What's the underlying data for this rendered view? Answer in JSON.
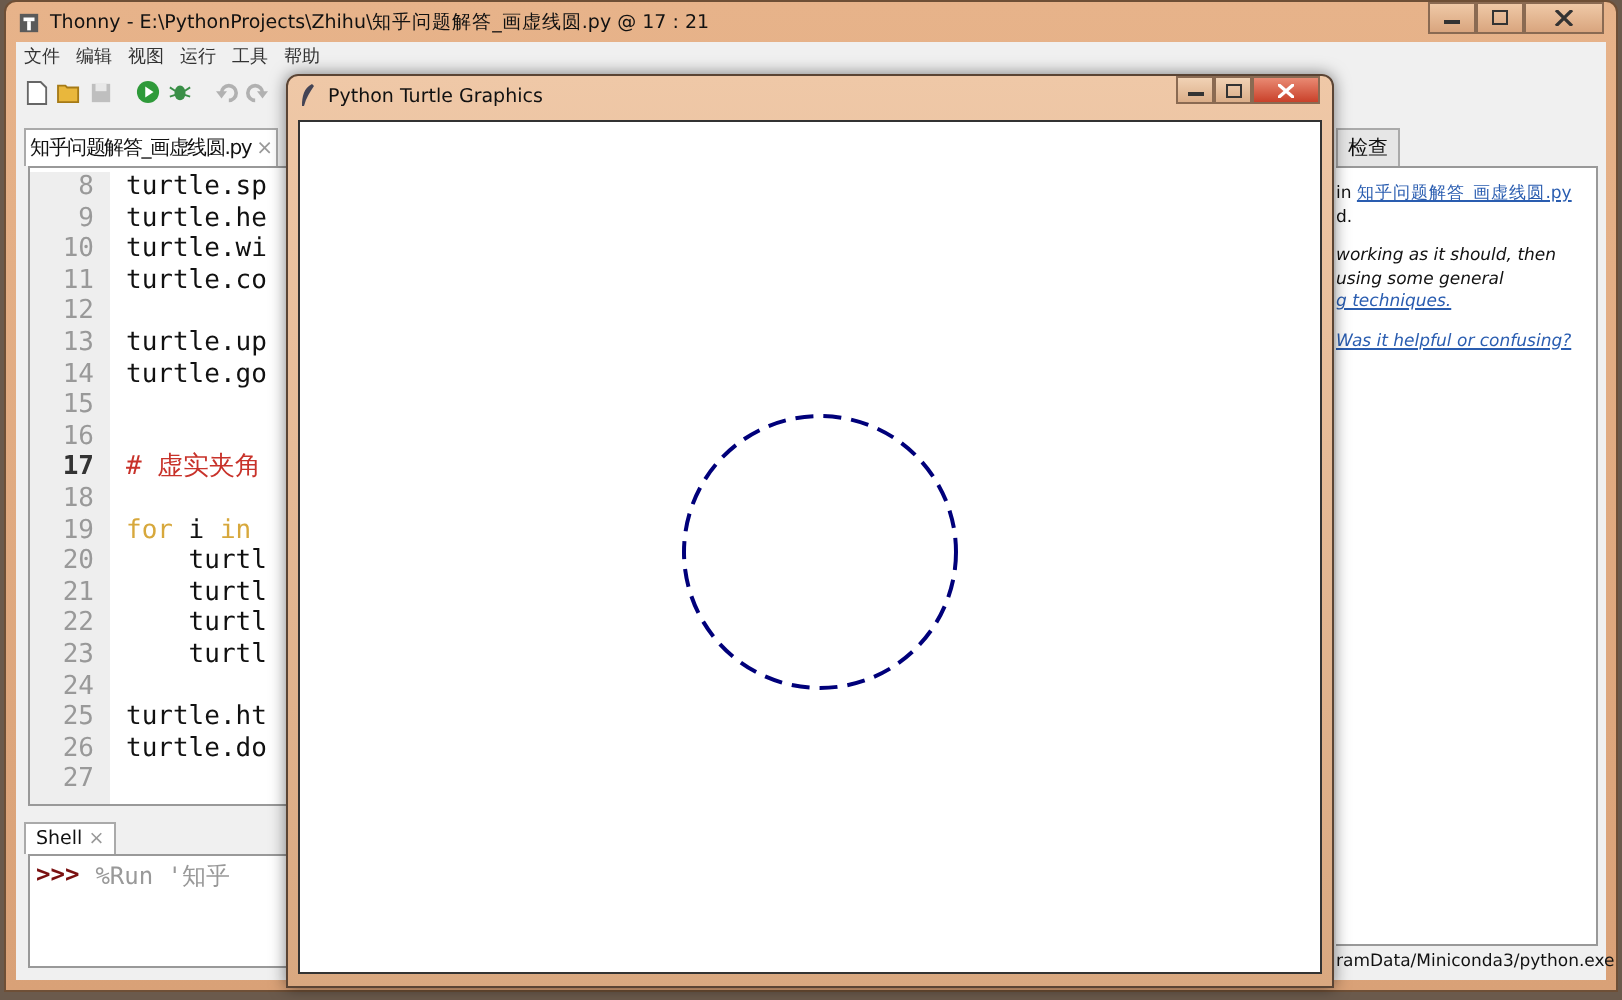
{
  "window": {
    "title": "Thonny  -  E:\\PythonProjects\\Zhihu\\知乎问题解答_画虚线圆.py  @  17 : 21"
  },
  "menu": [
    "文件",
    "编辑",
    "视图",
    "运行",
    "工具",
    "帮助"
  ],
  "toolbar": [
    {
      "kind": "new",
      "disabled": false
    },
    {
      "kind": "open",
      "disabled": false
    },
    {
      "kind": "save",
      "disabled": true
    },
    {
      "kind": "run",
      "disabled": false
    },
    {
      "kind": "debug",
      "disabled": false
    },
    {
      "kind": "undo",
      "disabled": true
    },
    {
      "kind": "redo",
      "disabled": true
    }
  ],
  "editor": {
    "tab": {
      "label": "知乎问题解答_画虚线圆.py",
      "close": "×"
    },
    "lines": [
      {
        "number": "8",
        "current": false,
        "tokens": [
          {
            "kind": "plain",
            "text": "turtle.sp"
          }
        ]
      },
      {
        "number": "9",
        "current": false,
        "tokens": [
          {
            "kind": "plain",
            "text": "turtle.he"
          }
        ]
      },
      {
        "number": "10",
        "current": false,
        "tokens": [
          {
            "kind": "plain",
            "text": "turtle.wi"
          }
        ]
      },
      {
        "number": "11",
        "current": false,
        "tokens": [
          {
            "kind": "plain",
            "text": "turtle.co"
          }
        ]
      },
      {
        "number": "12",
        "current": false
      },
      {
        "number": "13",
        "current": false,
        "tokens": [
          {
            "kind": "plain",
            "text": "turtle.up"
          }
        ]
      },
      {
        "number": "14",
        "current": false,
        "tokens": [
          {
            "kind": "plain",
            "text": "turtle.go"
          }
        ]
      },
      {
        "number": "15",
        "current": false
      },
      {
        "number": "16",
        "current": false
      },
      {
        "number": "17",
        "current": true,
        "tokens": [
          {
            "kind": "comment",
            "text": "# 虚实夹角"
          }
        ]
      },
      {
        "number": "18",
        "current": false
      },
      {
        "number": "19",
        "current": false,
        "tokens": [
          {
            "kind": "keyword",
            "text": "for"
          },
          {
            "kind": "plain",
            "text": " i "
          },
          {
            "kind": "keyword",
            "text": "in"
          }
        ]
      },
      {
        "number": "20",
        "current": false,
        "tokens": [
          {
            "kind": "plain",
            "text": "    turtl"
          }
        ]
      },
      {
        "number": "21",
        "current": false,
        "tokens": [
          {
            "kind": "plain",
            "text": "    turtl"
          }
        ]
      },
      {
        "number": "22",
        "current": false,
        "tokens": [
          {
            "kind": "plain",
            "text": "    turtl"
          }
        ]
      },
      {
        "number": "23",
        "current": false,
        "tokens": [
          {
            "kind": "plain",
            "text": "    turtl"
          }
        ]
      },
      {
        "number": "24",
        "current": false
      },
      {
        "number": "25",
        "current": false,
        "tokens": [
          {
            "kind": "plain",
            "text": "turtle.ht"
          }
        ]
      },
      {
        "number": "26",
        "current": false,
        "tokens": [
          {
            "kind": "plain",
            "text": "turtle.do"
          }
        ]
      },
      {
        "number": "27",
        "current": false
      }
    ]
  },
  "shell": {
    "tab": {
      "label": "Shell",
      "close": "×"
    },
    "prompt": ">>>",
    "command": "%Run '知乎"
  },
  "assistant": {
    "tab": "检查",
    "lines": [
      {
        "kind": "link",
        "prefix": "in ",
        "text": "知乎问题解答_画虚线圆.py"
      },
      {
        "kind": "plain",
        "text": "d."
      },
      {
        "kind": "italic",
        "text": "working as it should, then"
      },
      {
        "kind": "italic",
        "text": "using some general"
      },
      {
        "kind": "italic-link",
        "text": "g techniques."
      },
      {
        "kind": "feedback",
        "text": "Was it helpful or confusing?"
      }
    ]
  },
  "status_bar": {
    "interpreter": "ramData/Miniconda3/python.exe"
  },
  "turtle_window": {
    "title": "Python Turtle Graphics"
  }
}
